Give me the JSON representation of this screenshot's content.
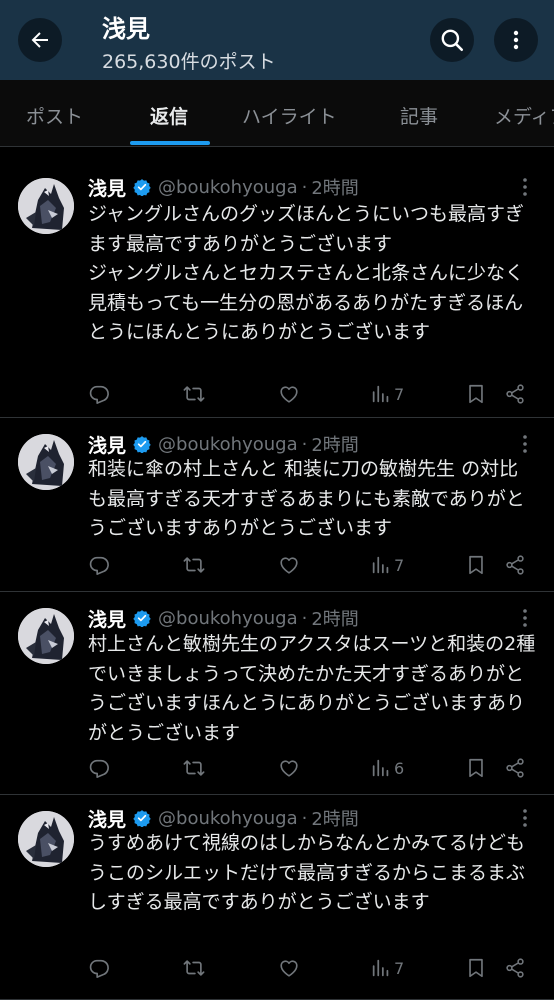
{
  "header": {
    "title": "浅見",
    "post_count": "265,630件のポスト"
  },
  "tabs": [
    "ポスト",
    "返信",
    "ハイライト",
    "記事",
    "メディア"
  ],
  "active_tab": "返信",
  "colors": {
    "header_bg": "#1a3346",
    "accent": "#1d9bf0",
    "verified": "#1d9bf0"
  },
  "icons": [
    "back-arrow-icon",
    "search-icon",
    "more-vertical-icon",
    "reply-icon",
    "repost-icon",
    "like-icon",
    "views-icon",
    "bookmark-icon",
    "share-icon",
    "verified-badge-icon"
  ],
  "posts": [
    {
      "author": "浅見",
      "handle": "@boukohyouga",
      "separator": "·",
      "time": "2時間",
      "text": "ジャングルさんのグッズほんとうにいつも最高すぎます最高ですありがとうございます\nジャングルさんとセカステさんと北条さんに少なく見積もっても一生分の恩があるありがたすぎるほんとうにほんとうにありがとうございます",
      "views": "7"
    },
    {
      "author": "浅見",
      "handle": "@boukohyouga",
      "separator": "·",
      "time": "2時間",
      "text": "和装に傘の村上さんと 和装に刀の敏樹先生 の対比も最高すぎる天才すぎるあまりにも素敵でありがとうございますありがとうございます",
      "views": "7"
    },
    {
      "author": "浅見",
      "handle": "@boukohyouga",
      "separator": "·",
      "time": "2時間",
      "text": "村上さんと敏樹先生のアクスタはスーツと和装の2種でいきましょうって決めたかた天才すぎるありがとうございますほんとうにありがとうございますありがとうございます",
      "views": "6"
    },
    {
      "author": "浅見",
      "handle": "@boukohyouga",
      "separator": "·",
      "time": "2時間",
      "text": "うすめあけて視線のはしからなんとかみてるけどもうこのシルエットだけで最高すぎるからこまるまぶしすぎる最高ですありがとうございます",
      "views": "7"
    }
  ]
}
